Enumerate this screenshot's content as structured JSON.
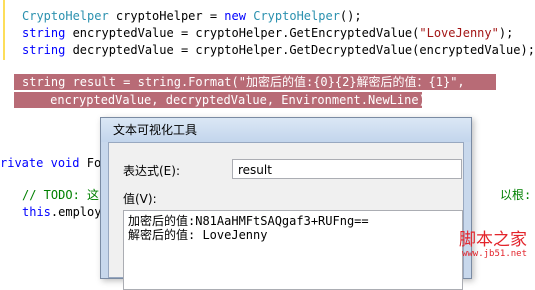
{
  "code": {
    "line1": {
      "t1": "CryptoHelper",
      "t2": " cryptoHelper = ",
      "t3": "new",
      "t4": " ",
      "t5": "CryptoHelper",
      "t6": "();"
    },
    "line2": {
      "kw": "string",
      "t2": " encryptedValue = cryptoHelper.GetEncryptedValue(",
      "str": "\"LoveJenny\"",
      "t3": ");"
    },
    "line3": {
      "kw": "string",
      "t2": " decryptedValue = cryptoHelper.GetDecryptedValue(encryptedValue);"
    },
    "sel1": "string result = string.Format(\"加密后的值:{0}{2}解密后的值：{1}\",",
    "sel2": "     encryptedValue, decryptedValue, Environment.NewLine);",
    "line6": {
      "kw": "rivate",
      "t2": " ",
      "kw2": "void",
      "t3": " Fo"
    },
    "line7": {
      "comment": "// TODO: 这"
    },
    "line8": {
      "kw": "this",
      "t2": ".employ"
    },
    "line7_tail": "以根:"
  },
  "dialog": {
    "title": "文本可视化工具",
    "expr_label": "表达式(E):",
    "expr_value": "result",
    "value_label": "值(V):",
    "value_line1": "加密后的值:N81AaHMFtSAQgaf3+RUFng==",
    "value_line2": "解密后的值: LoveJenny"
  },
  "watermark": {
    "main": "脚本之家",
    "sub": "www.jb51.net"
  }
}
